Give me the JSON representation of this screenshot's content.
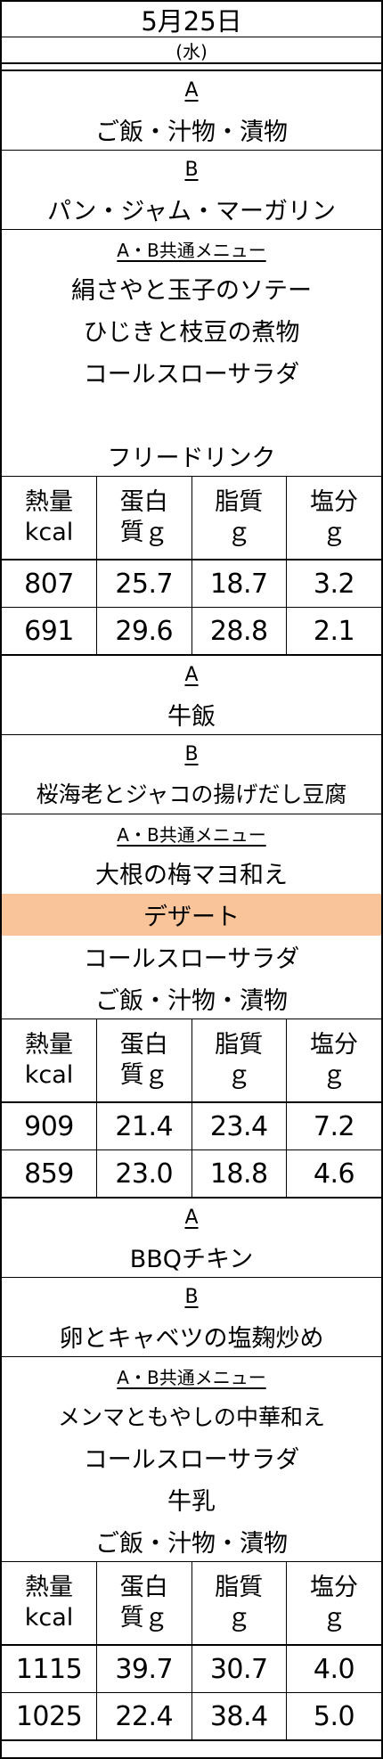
{
  "header": {
    "date": "5月25日",
    "weekday": "(水)"
  },
  "nutrition_labels": {
    "energy": [
      "熱量",
      "kcal"
    ],
    "protein": [
      "蛋白",
      "質ｇ"
    ],
    "fat": [
      "脂質",
      "ｇ"
    ],
    "salt": [
      "塩分",
      "ｇ"
    ]
  },
  "meals": [
    {
      "a_label": "A",
      "a_items": [
        "ご飯・汁物・漬物"
      ],
      "b_label": "B",
      "b_items": [
        "パン・ジャム・マーガリン"
      ],
      "common_label": "A・B共通メニュー",
      "common_items": [
        "絹さやと玉子のソテー",
        "ひじきと枝豆の煮物",
        "コールスローサラダ",
        "",
        "フリードリンク"
      ],
      "nutrition": [
        [
          "807",
          "25.7",
          "18.7",
          "3.2"
        ],
        [
          "691",
          "29.6",
          "28.8",
          "2.1"
        ]
      ]
    },
    {
      "a_label": "A",
      "a_items": [
        "牛飯"
      ],
      "b_label": "B",
      "b_items": [
        "桜海老とジャコの揚げだし豆腐"
      ],
      "common_label": "A・B共通メニュー",
      "common_items": [
        "大根の梅マヨ和え",
        "デザート",
        "コールスローサラダ",
        "ご飯・汁物・漬物"
      ],
      "nutrition": [
        [
          "909",
          "21.4",
          "23.4",
          "7.2"
        ],
        [
          "859",
          "23.0",
          "18.8",
          "4.6"
        ]
      ]
    },
    {
      "a_label": "A",
      "a_items": [
        "BBQチキン"
      ],
      "b_label": "B",
      "b_items": [
        "卵とキャベツの塩麹炒め"
      ],
      "common_label": "A・B共通メニュー",
      "common_items": [
        "メンマともやしの中華和え",
        "コールスローサラダ",
        "牛乳",
        "ご飯・汁物・漬物"
      ],
      "nutrition": [
        [
          "1115",
          "39.7",
          "30.7",
          "4.0"
        ],
        [
          "1025",
          "22.4",
          "38.4",
          "5.0"
        ]
      ]
    }
  ],
  "highlight_color": "#f9c49a"
}
